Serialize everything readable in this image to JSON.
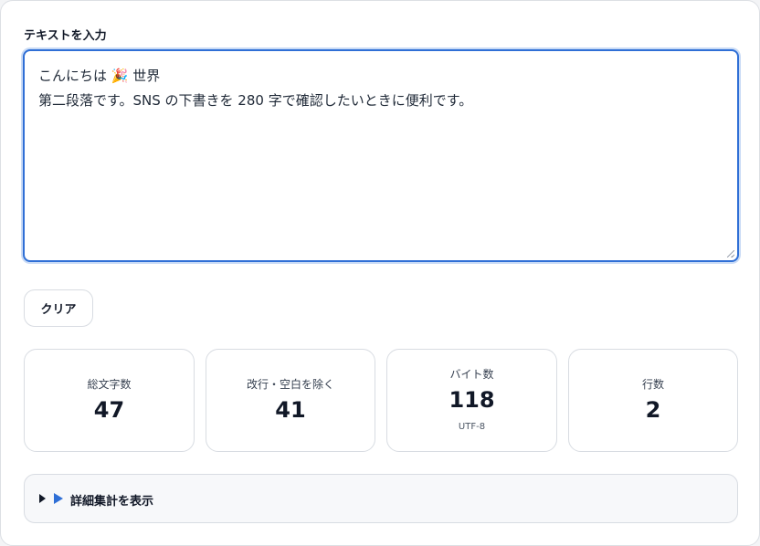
{
  "input": {
    "label": "テキストを入力",
    "line1": "こんにちは 🎉 世界",
    "line2": "第二段落です。SNS の下書きを 280 字で確認したいときに便利です。"
  },
  "actions": {
    "clear_label": "クリア"
  },
  "stats": [
    {
      "label": "総文字数",
      "value": "47"
    },
    {
      "label": "改行・空白を除く",
      "value": "41"
    },
    {
      "label": "バイト数",
      "value": "118",
      "sub": "UTF-8"
    },
    {
      "label": "行数",
      "value": "2"
    }
  ],
  "details": {
    "summary": "詳細集計を表示"
  },
  "colors": {
    "accent": "#2f6fd6",
    "text": "#111827",
    "border": "#d8dce2"
  }
}
